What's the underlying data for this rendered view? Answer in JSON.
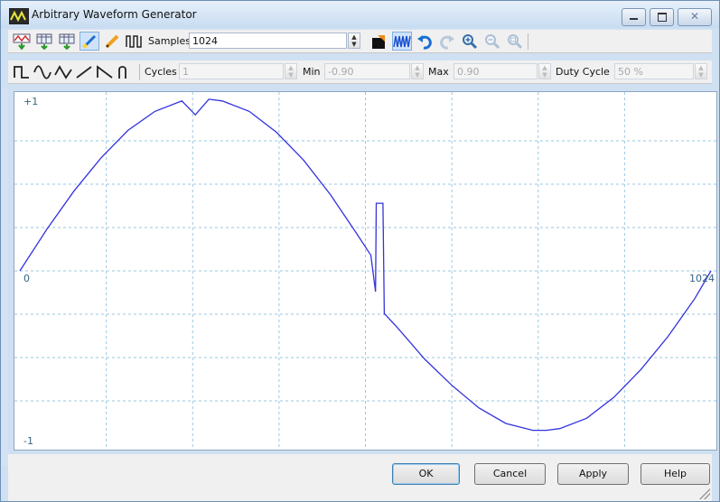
{
  "window": {
    "title": "Arbitrary Waveform Generator",
    "controls": [
      "minimize",
      "maximize",
      "close"
    ]
  },
  "toolbar_main": {
    "icons": [
      "load-waveform-icon",
      "import-icon",
      "export-icon",
      "brush-icon",
      "pencil-icon",
      "samples-icon"
    ],
    "samples_label": "Samples",
    "samples_value": "1024",
    "right_icons": [
      "color-picker-icon",
      "waveform-view-icon",
      "undo-icon",
      "redo-icon",
      "zoom-in-icon",
      "zoom-out-icon",
      "zoom-fit-icon"
    ]
  },
  "toolbar_shapes": {
    "shapes": [
      "square-wave-icon",
      "sine-wave-icon",
      "triangle-wave-icon",
      "ramp-up-icon",
      "ramp-down-icon",
      "exponential-icon"
    ],
    "cycles_label": "Cycles",
    "cycles_value": "1",
    "min_label": "Min",
    "min_value": "-0.90",
    "max_label": "Max",
    "max_value": "0.90",
    "duty_label": "Duty Cycle",
    "duty_value": "50 %"
  },
  "graph": {
    "y_max_label": "+1",
    "y_min_label": "-1",
    "x_start_label": "0",
    "x_end_label": "1024",
    "line_color": "#3333dd",
    "grid_color": "#9ac7e0"
  },
  "chart_data": {
    "type": "line",
    "xlim": [
      0,
      1024
    ],
    "ylim": [
      -1,
      1
    ],
    "series": [
      {
        "x": [
          0,
          40,
          80,
          120,
          160,
          200,
          240,
          260,
          280,
          300,
          340,
          380,
          420,
          460,
          500,
          520,
          527,
          528,
          538,
          540,
          541,
          560,
          600,
          640,
          680,
          720,
          760,
          780,
          800,
          840,
          880,
          920,
          960,
          1000,
          1024
        ],
        "y": [
          0.0,
          0.24,
          0.46,
          0.65,
          0.81,
          0.92,
          0.98,
          0.9,
          0.99,
          0.98,
          0.92,
          0.8,
          0.64,
          0.44,
          0.21,
          0.09,
          -0.12,
          0.39,
          0.39,
          -0.25,
          -0.25,
          -0.33,
          -0.51,
          -0.66,
          -0.79,
          -0.88,
          -0.92,
          -0.92,
          -0.91,
          -0.85,
          -0.73,
          -0.57,
          -0.38,
          -0.16,
          0.0
        ]
      }
    ]
  },
  "buttons": {
    "ok": "OK",
    "cancel": "Cancel",
    "apply": "Apply",
    "help": "Help"
  }
}
